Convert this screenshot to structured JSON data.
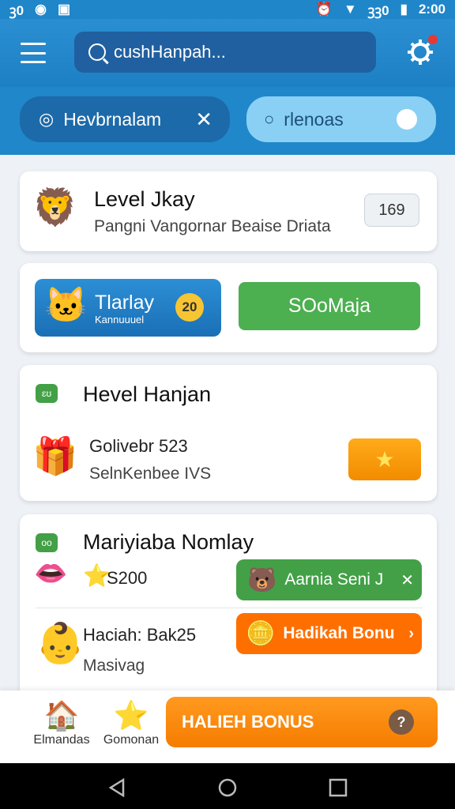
{
  "status_bar": {
    "left_text": "ꝫ0",
    "network": "ꝫꝫ0",
    "time": "2:00"
  },
  "header": {
    "search_placeholder": "cushHanpah..."
  },
  "chips": {
    "dark_label": "Hevbrnalam",
    "light_label": "rlenoas"
  },
  "card1": {
    "title": "Level Jkay",
    "subtitle": "Pangni Vangornar Beaise Driata",
    "badge": "169"
  },
  "card2": {
    "blue_title": "Tlarlay",
    "blue_sub": "Kannuuuel",
    "coin": "20",
    "green_label": "SOoMaja"
  },
  "card3": {
    "section_icon": "ɛʊ",
    "title": "Hevel Hanjan",
    "item_title": "Golivebr 523",
    "item_sub": "SelnKenbee IVS"
  },
  "card4": {
    "section_icon": "oo",
    "title": "Mariyiaba Nomlay",
    "row1_value": "S200",
    "row1_button": "Aarnia Seni J",
    "row2_title": "Haciah: Bak25",
    "row2_sub": "Masivag",
    "row2_button": "Hadikah Bonu"
  },
  "bottom_nav": {
    "home_label": "Elmandas",
    "star_label": "Gomonan",
    "bonus_label": "HALIEH BONUS"
  },
  "colors": {
    "primary_blue": "#2087ca",
    "green": "#43a047",
    "orange": "#f57c00"
  }
}
